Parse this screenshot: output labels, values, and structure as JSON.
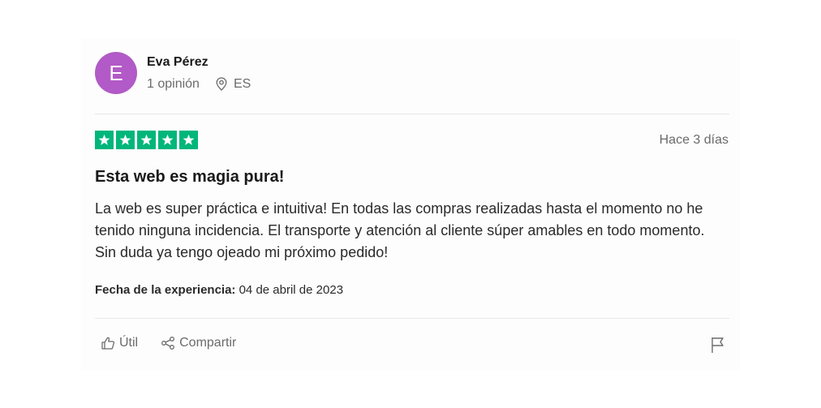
{
  "reviewer": {
    "initial": "E",
    "name": "Eva Pérez",
    "reviews_count": "1 opinión",
    "country": "ES",
    "avatar_color": "#b25ac7"
  },
  "review": {
    "rating": 5,
    "max_rating": 5,
    "star_color": "#00b67a",
    "date": "Hace 3 días",
    "title": "Esta web es magia pura!",
    "body": "La web es super práctica e intuitiva! En todas las compras realizadas hasta el momento no he tenido ninguna incidencia. El transporte y atención al cliente súper amables en todo momento. Sin duda ya tengo ojeado mi próximo pedido!",
    "experience_label": "Fecha de la experiencia:",
    "experience_date": "04 de abril de 2023"
  },
  "actions": {
    "useful_label": "Útil",
    "share_label": "Compartir",
    "icons": [
      "thumbs-up-icon",
      "share-icon",
      "flag-icon",
      "location-pin-icon",
      "star-icon"
    ]
  }
}
